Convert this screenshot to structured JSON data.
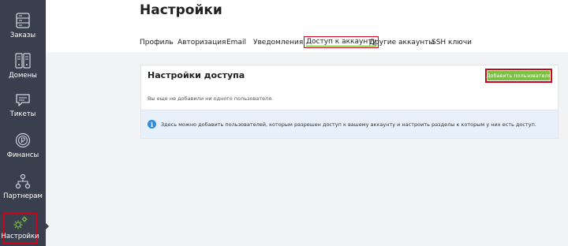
{
  "sidebar": {
    "items": [
      {
        "label": "Заказы",
        "icon": "server-icon"
      },
      {
        "label": "Домены",
        "icon": "server-rack-icon"
      },
      {
        "label": "Тикеты",
        "icon": "chat-icon"
      },
      {
        "label": "Финансы",
        "icon": "coin-icon"
      },
      {
        "label": "Партнерам",
        "icon": "network-icon"
      },
      {
        "label": "Настройки",
        "icon": "gears-icon"
      }
    ],
    "active_index": 5
  },
  "header": {
    "title": "Настройки",
    "tabs": [
      {
        "label": "Профиль"
      },
      {
        "label": "Авторизация"
      },
      {
        "label": "Email"
      },
      {
        "label": "Уведомления"
      },
      {
        "label": "Доступ к аккаунту"
      },
      {
        "label": "Другие аккаунты"
      },
      {
        "label": "SSH ключи"
      }
    ],
    "active_tab_index": 4
  },
  "access_card": {
    "title": "Настройки доступа",
    "add_user_label": "Добавить пользователя",
    "empty_text": "Вы еще не добавили ни одного пользователя.",
    "info_text": "Здесь можно добавить пользователей, которым разрешен доступ к вашему аккаунту и настроить разделы к которым у них есть доступ."
  },
  "colors": {
    "sidebar_bg": "#3a3f4d",
    "accent_green": "#7bc142",
    "highlight_red": "#d0021b",
    "info_blue": "#2f8cde",
    "info_bg": "#e8f1fb"
  }
}
